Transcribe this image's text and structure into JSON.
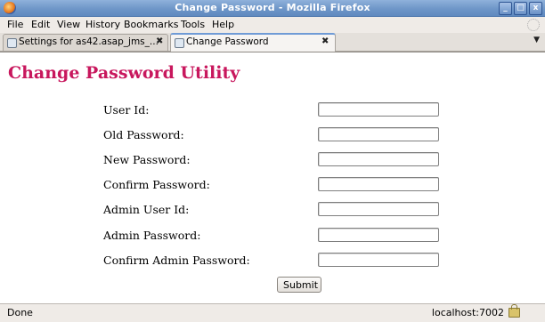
{
  "window": {
    "title": "Change Password - Mozilla Firefox",
    "controls": [
      "_",
      "□",
      "x"
    ]
  },
  "menu": [
    "File",
    "Edit",
    "View",
    "History",
    "Bookmarks",
    "Tools",
    "Help"
  ],
  "tabs": [
    {
      "label": "Settings for as42.asap_jms_...",
      "close": "✖"
    },
    {
      "label": "Change Password",
      "close": "✖"
    }
  ],
  "tab_list_arrow": "▼",
  "page": {
    "title": "Change Password Utility",
    "fields": [
      {
        "label": "User Id:",
        "value": ""
      },
      {
        "label": "Old Password:",
        "value": ""
      },
      {
        "label": "New Password:",
        "value": ""
      },
      {
        "label": "Confirm Password:",
        "value": ""
      },
      {
        "label": "Admin User Id:",
        "value": ""
      },
      {
        "label": "Admin Password:",
        "value": ""
      },
      {
        "label": "Confirm Admin Password:",
        "value": ""
      }
    ],
    "submit_label": "Submit"
  },
  "status": {
    "text": "Done",
    "host": "localhost:7002"
  }
}
